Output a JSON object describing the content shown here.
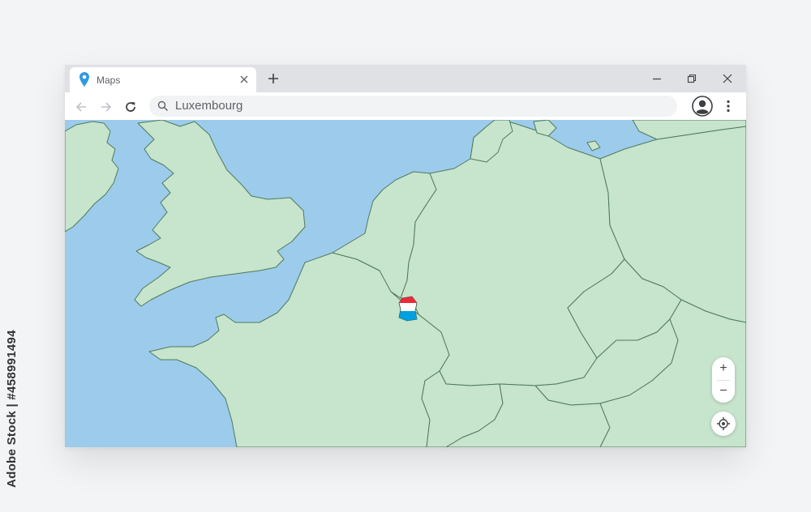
{
  "tab": {
    "title": "Maps",
    "pin_icon": "map-pin-icon",
    "close_icon": "close-icon"
  },
  "toolbar": {
    "back_icon": "arrow-left-icon",
    "forward_icon": "arrow-right-icon",
    "reload_icon": "reload-icon",
    "search_value": "Luxembourg",
    "avatar_icon": "account-icon",
    "menu_icon": "kebab-menu-icon"
  },
  "window_controls": [
    "minimize-icon",
    "restore-icon",
    "close-icon"
  ],
  "map": {
    "highlight_country": "Luxembourg",
    "flag_colors": [
      "#ed2939",
      "#ffffff",
      "#00a1de"
    ],
    "colors": {
      "water": "#9ccbeb",
      "land": "#c7e4cc",
      "border": "#4f7a5c"
    }
  },
  "map_controls": {
    "zoom_in": "+",
    "zoom_out": "−",
    "locate_icon": "crosshair-icon"
  },
  "side_text": "Adobe Stock | #458991494"
}
